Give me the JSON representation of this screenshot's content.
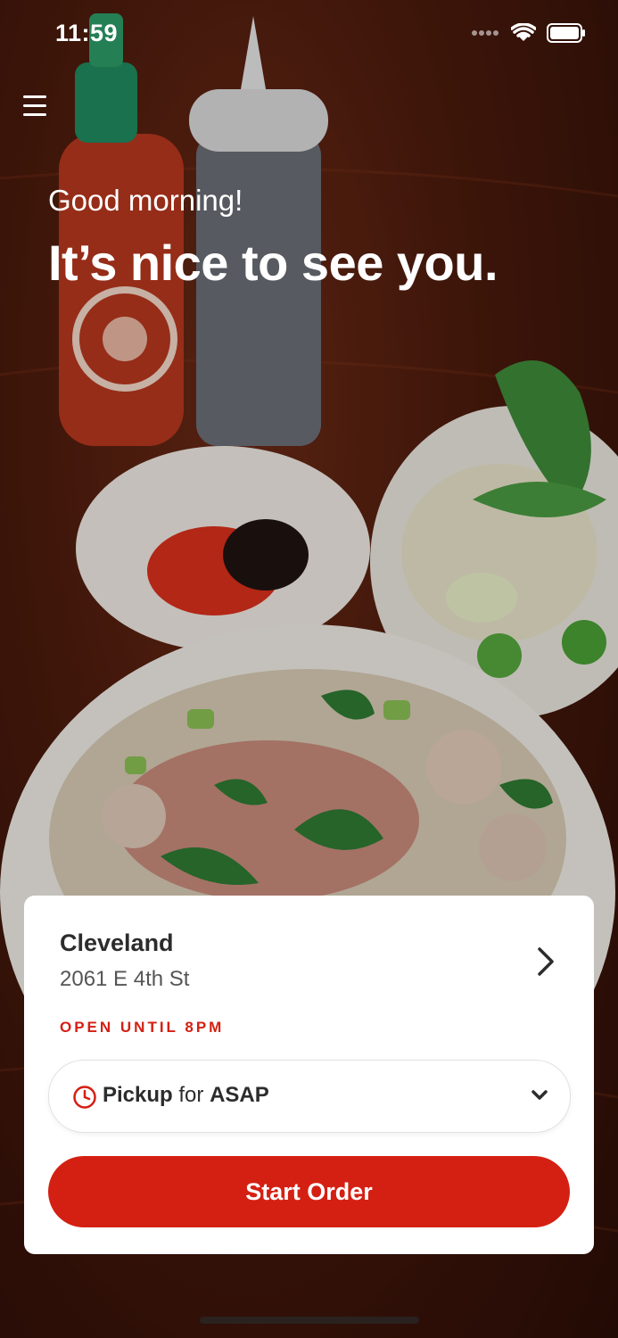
{
  "status_bar": {
    "time": "11:59"
  },
  "greeting": "Good morning!",
  "headline": "It’s nice to see you.",
  "location": {
    "name": "Cleveland",
    "address": "2061 E 4th St",
    "status": "OPEN UNTIL 8PM"
  },
  "order_mode": {
    "mode": "Pickup",
    "connector": "for",
    "time": "ASAP"
  },
  "cta": {
    "label": "Start Order"
  },
  "colors": {
    "accent": "#d42013",
    "card": "#ffffff",
    "text": "#2c2c2c"
  },
  "icons": {
    "menu": "hamburger-icon",
    "location_chevron": "chevron-right-icon",
    "pickup": "clock-icon",
    "pickup_caret": "chevron-down-icon"
  }
}
